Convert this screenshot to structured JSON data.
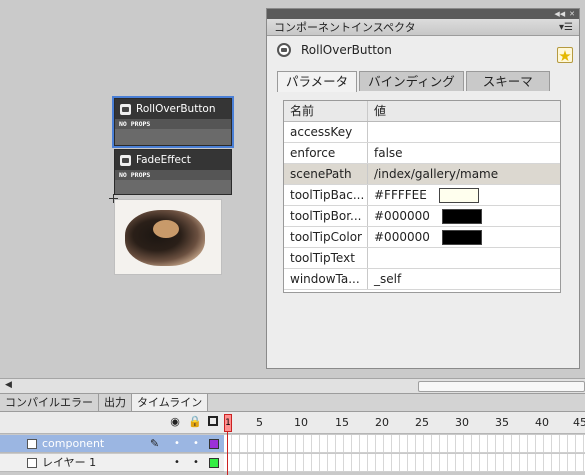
{
  "stage": {
    "components": [
      {
        "name": "RollOverButton",
        "props": "NO PROPS"
      },
      {
        "name": "FadeEffect",
        "props": "NO PROPS"
      }
    ]
  },
  "inspector": {
    "title": "コンポーネントインスペクタ",
    "component_name": "RollOverButton",
    "tabs": [
      "パラメータ",
      "バインディング",
      "スキーマ"
    ],
    "active_tab": "パラメータ",
    "columns": [
      "名前",
      "値"
    ],
    "rows": [
      {
        "name": "accessKey",
        "value": ""
      },
      {
        "name": "enforce",
        "value": "false"
      },
      {
        "name": "scenePath",
        "value": "/index/gallery/mame"
      },
      {
        "name": "toolTipBac...",
        "value": "#FFFFEE",
        "swatch": "#FFFFEE"
      },
      {
        "name": "toolTipBor...",
        "value": "#000000",
        "swatch": "#000000"
      },
      {
        "name": "toolTipColor",
        "value": "#000000",
        "swatch": "#000000"
      },
      {
        "name": "toolTipText",
        "value": ""
      },
      {
        "name": "windowTa...",
        "value": "_self"
      }
    ]
  },
  "bottom_tabs": [
    "コンパイルエラー",
    "出力",
    "タイムライン"
  ],
  "timeline": {
    "frame_numbers": [
      "1",
      "5",
      "10",
      "15",
      "20",
      "25",
      "30",
      "35",
      "40",
      "45"
    ],
    "current_frame": "1",
    "layers": [
      {
        "name": "component",
        "color": "#9b30d9",
        "active": true
      },
      {
        "name": "レイヤー 1",
        "color": "#33ee44",
        "active": false
      }
    ]
  },
  "colors": {
    "selection": "#4a7fd6",
    "playhead": "#cc2222",
    "active_layer": "#9bb6e2"
  }
}
